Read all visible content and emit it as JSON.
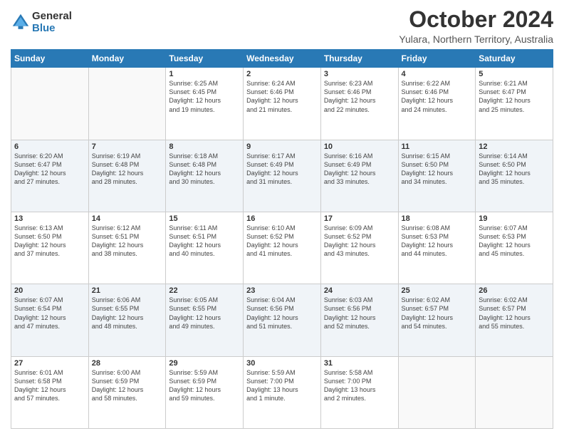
{
  "header": {
    "logo_line1": "General",
    "logo_line2": "Blue",
    "title": "October 2024",
    "subtitle": "Yulara, Northern Territory, Australia"
  },
  "days_of_week": [
    "Sunday",
    "Monday",
    "Tuesday",
    "Wednesday",
    "Thursday",
    "Friday",
    "Saturday"
  ],
  "weeks": [
    [
      {
        "day": "",
        "info": ""
      },
      {
        "day": "",
        "info": ""
      },
      {
        "day": "1",
        "info": "Sunrise: 6:25 AM\nSunset: 6:45 PM\nDaylight: 12 hours\nand 19 minutes."
      },
      {
        "day": "2",
        "info": "Sunrise: 6:24 AM\nSunset: 6:46 PM\nDaylight: 12 hours\nand 21 minutes."
      },
      {
        "day": "3",
        "info": "Sunrise: 6:23 AM\nSunset: 6:46 PM\nDaylight: 12 hours\nand 22 minutes."
      },
      {
        "day": "4",
        "info": "Sunrise: 6:22 AM\nSunset: 6:46 PM\nDaylight: 12 hours\nand 24 minutes."
      },
      {
        "day": "5",
        "info": "Sunrise: 6:21 AM\nSunset: 6:47 PM\nDaylight: 12 hours\nand 25 minutes."
      }
    ],
    [
      {
        "day": "6",
        "info": "Sunrise: 6:20 AM\nSunset: 6:47 PM\nDaylight: 12 hours\nand 27 minutes."
      },
      {
        "day": "7",
        "info": "Sunrise: 6:19 AM\nSunset: 6:48 PM\nDaylight: 12 hours\nand 28 minutes."
      },
      {
        "day": "8",
        "info": "Sunrise: 6:18 AM\nSunset: 6:48 PM\nDaylight: 12 hours\nand 30 minutes."
      },
      {
        "day": "9",
        "info": "Sunrise: 6:17 AM\nSunset: 6:49 PM\nDaylight: 12 hours\nand 31 minutes."
      },
      {
        "day": "10",
        "info": "Sunrise: 6:16 AM\nSunset: 6:49 PM\nDaylight: 12 hours\nand 33 minutes."
      },
      {
        "day": "11",
        "info": "Sunrise: 6:15 AM\nSunset: 6:50 PM\nDaylight: 12 hours\nand 34 minutes."
      },
      {
        "day": "12",
        "info": "Sunrise: 6:14 AM\nSunset: 6:50 PM\nDaylight: 12 hours\nand 35 minutes."
      }
    ],
    [
      {
        "day": "13",
        "info": "Sunrise: 6:13 AM\nSunset: 6:50 PM\nDaylight: 12 hours\nand 37 minutes."
      },
      {
        "day": "14",
        "info": "Sunrise: 6:12 AM\nSunset: 6:51 PM\nDaylight: 12 hours\nand 38 minutes."
      },
      {
        "day": "15",
        "info": "Sunrise: 6:11 AM\nSunset: 6:51 PM\nDaylight: 12 hours\nand 40 minutes."
      },
      {
        "day": "16",
        "info": "Sunrise: 6:10 AM\nSunset: 6:52 PM\nDaylight: 12 hours\nand 41 minutes."
      },
      {
        "day": "17",
        "info": "Sunrise: 6:09 AM\nSunset: 6:52 PM\nDaylight: 12 hours\nand 43 minutes."
      },
      {
        "day": "18",
        "info": "Sunrise: 6:08 AM\nSunset: 6:53 PM\nDaylight: 12 hours\nand 44 minutes."
      },
      {
        "day": "19",
        "info": "Sunrise: 6:07 AM\nSunset: 6:53 PM\nDaylight: 12 hours\nand 45 minutes."
      }
    ],
    [
      {
        "day": "20",
        "info": "Sunrise: 6:07 AM\nSunset: 6:54 PM\nDaylight: 12 hours\nand 47 minutes."
      },
      {
        "day": "21",
        "info": "Sunrise: 6:06 AM\nSunset: 6:55 PM\nDaylight: 12 hours\nand 48 minutes."
      },
      {
        "day": "22",
        "info": "Sunrise: 6:05 AM\nSunset: 6:55 PM\nDaylight: 12 hours\nand 49 minutes."
      },
      {
        "day": "23",
        "info": "Sunrise: 6:04 AM\nSunset: 6:56 PM\nDaylight: 12 hours\nand 51 minutes."
      },
      {
        "day": "24",
        "info": "Sunrise: 6:03 AM\nSunset: 6:56 PM\nDaylight: 12 hours\nand 52 minutes."
      },
      {
        "day": "25",
        "info": "Sunrise: 6:02 AM\nSunset: 6:57 PM\nDaylight: 12 hours\nand 54 minutes."
      },
      {
        "day": "26",
        "info": "Sunrise: 6:02 AM\nSunset: 6:57 PM\nDaylight: 12 hours\nand 55 minutes."
      }
    ],
    [
      {
        "day": "27",
        "info": "Sunrise: 6:01 AM\nSunset: 6:58 PM\nDaylight: 12 hours\nand 57 minutes."
      },
      {
        "day": "28",
        "info": "Sunrise: 6:00 AM\nSunset: 6:59 PM\nDaylight: 12 hours\nand 58 minutes."
      },
      {
        "day": "29",
        "info": "Sunrise: 5:59 AM\nSunset: 6:59 PM\nDaylight: 12 hours\nand 59 minutes."
      },
      {
        "day": "30",
        "info": "Sunrise: 5:59 AM\nSunset: 7:00 PM\nDaylight: 13 hours\nand 1 minute."
      },
      {
        "day": "31",
        "info": "Sunrise: 5:58 AM\nSunset: 7:00 PM\nDaylight: 13 hours\nand 2 minutes."
      },
      {
        "day": "",
        "info": ""
      },
      {
        "day": "",
        "info": ""
      }
    ]
  ]
}
